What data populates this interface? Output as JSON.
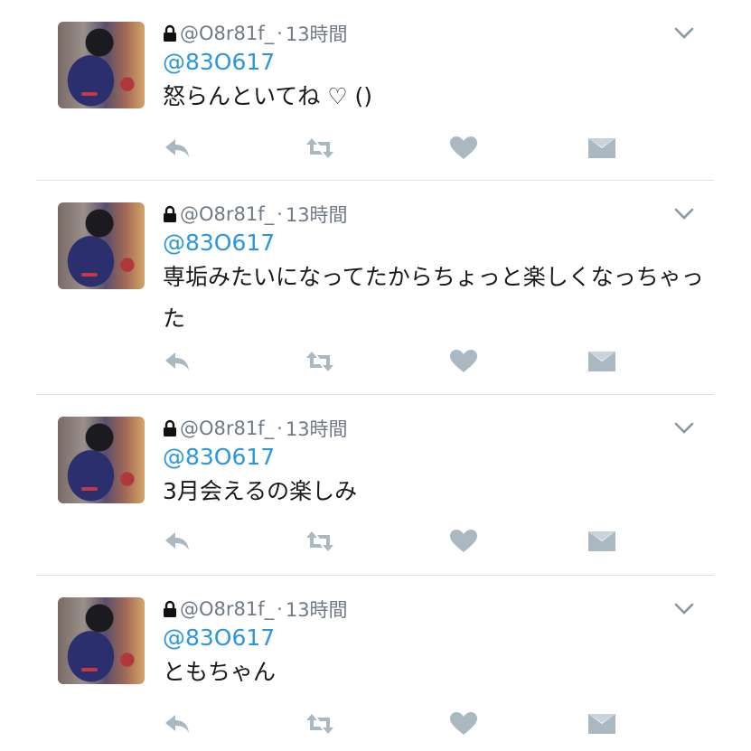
{
  "tweets": [
    {
      "lock": "🔒",
      "handle": "@O8r81f_",
      "separator": "·",
      "time": "13時間",
      "mention": "@83O617",
      "text": "怒らんといてね ♡ ()"
    },
    {
      "lock": "🔒",
      "handle": "@O8r81f_",
      "separator": "·",
      "time": "13時間",
      "mention": "@83O617",
      "text": "専垢みたいになってたからちょっと楽しくなっちゃった"
    },
    {
      "lock": "🔒",
      "handle": "@O8r81f_",
      "separator": "·",
      "time": "13時間",
      "mention": "@83O617",
      "text": "3月会えるの楽しみ"
    },
    {
      "lock": "🔒",
      "handle": "@O8r81f_",
      "separator": "·",
      "time": "13時間",
      "mention": "@83O617",
      "text": "ともちゃん"
    }
  ],
  "icons": {
    "reply": "reply-icon",
    "retweet": "retweet-icon",
    "like": "heart-icon",
    "dm": "envelope-icon",
    "more": "chevron-down-icon",
    "lock": "lock-icon"
  },
  "colors": {
    "mention": "#2b96e0",
    "meta": "#6f7a84",
    "action_icons": "#aab8c2",
    "text": "#1a1a1a"
  }
}
